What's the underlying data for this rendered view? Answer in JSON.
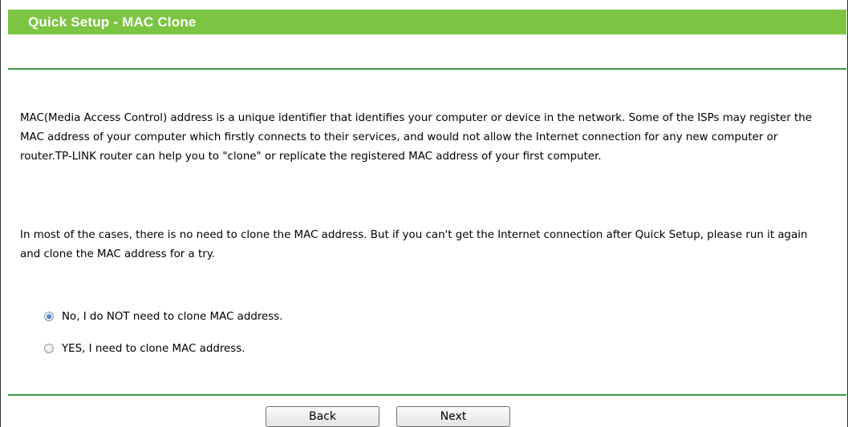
{
  "header": {
    "title": "Quick Setup - MAC Clone"
  },
  "content": {
    "paragraph1": "MAC(Media Access Control) address is a unique identifier that identifies your computer or device in the network. Some of the ISPs may register the MAC address of your computer which firstly connects to their services, and would not allow the Internet connection for any new computer or router.TP-LINK router can help you to \"clone\" or replicate the registered MAC address of your first computer.",
    "paragraph2": "In most of the cases, there is no need to clone the MAC address. But if you can't get the Internet connection after Quick Setup, please run it again and clone the MAC address for a try."
  },
  "options": {
    "no_clone": {
      "label": "No, I do NOT need to clone MAC address.",
      "checked": true
    },
    "yes_clone": {
      "label": "YES, I need to clone MAC address.",
      "checked": false
    }
  },
  "buttons": {
    "back_label": "Back",
    "next_label": "Next"
  },
  "colors": {
    "header_bg": "#7cc542",
    "rule": "#3e9a4a"
  }
}
